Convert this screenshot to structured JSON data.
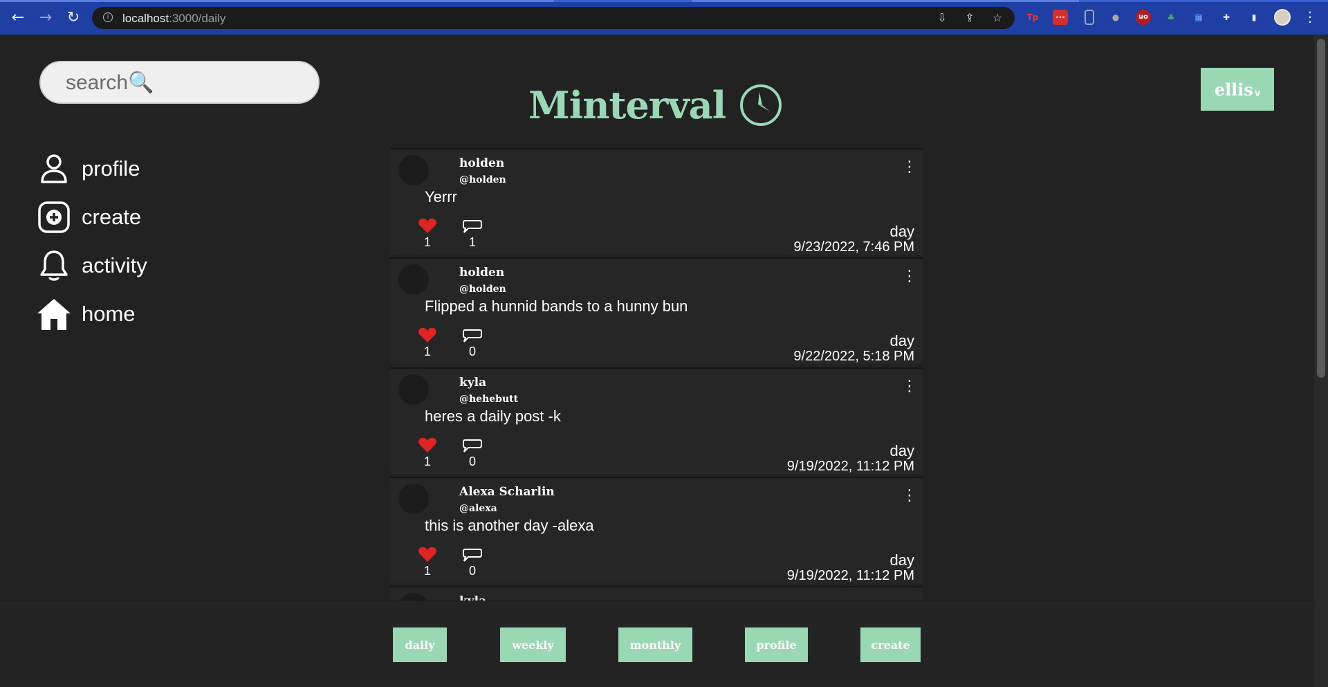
{
  "browser": {
    "url_host": "localhost",
    "url_rest": ":3000/daily"
  },
  "search": {
    "placeholder": "search🔍"
  },
  "sidebar": {
    "items": [
      {
        "label": "profile",
        "icon": "person-icon"
      },
      {
        "label": "create",
        "icon": "plus-square-icon"
      },
      {
        "label": "activity",
        "icon": "bell-icon"
      },
      {
        "label": "home",
        "icon": "house-icon"
      }
    ]
  },
  "brand": {
    "title": "Minterval",
    "accent": "#9ad7b4"
  },
  "user": {
    "name": "ellis",
    "caret": "v"
  },
  "posts": [
    {
      "name": "holden",
      "handle": "@holden",
      "body": "Yerrr",
      "likes": "1",
      "comments": "1",
      "interval": "day",
      "timestamp": "9/23/2022, 7:46 PM"
    },
    {
      "name": "holden",
      "handle": "@holden",
      "body": "Flipped a hunnid bands to a hunny bun",
      "likes": "1",
      "comments": "0",
      "interval": "day",
      "timestamp": "9/22/2022, 5:18 PM"
    },
    {
      "name": "kyla",
      "handle": "@hehebutt",
      "body": "heres a daily post -k",
      "likes": "1",
      "comments": "0",
      "interval": "day",
      "timestamp": "9/19/2022, 11:12 PM"
    },
    {
      "name": "Alexa Scharlin",
      "handle": "@alexa",
      "body": "this is another day -alexa",
      "likes": "1",
      "comments": "0",
      "interval": "day",
      "timestamp": "9/19/2022, 11:12 PM"
    },
    {
      "name": "kyla",
      "handle": "",
      "body": "",
      "likes": "",
      "comments": "",
      "interval": "",
      "timestamp": ""
    }
  ],
  "bottom_nav": {
    "daily": "daily",
    "weekly": "weekly",
    "monthly": "monthly",
    "profile": "profile",
    "create": "create"
  },
  "colors": {
    "background": "#222222",
    "like": "#e02424",
    "chrome_bar": "#1f3fa5"
  }
}
